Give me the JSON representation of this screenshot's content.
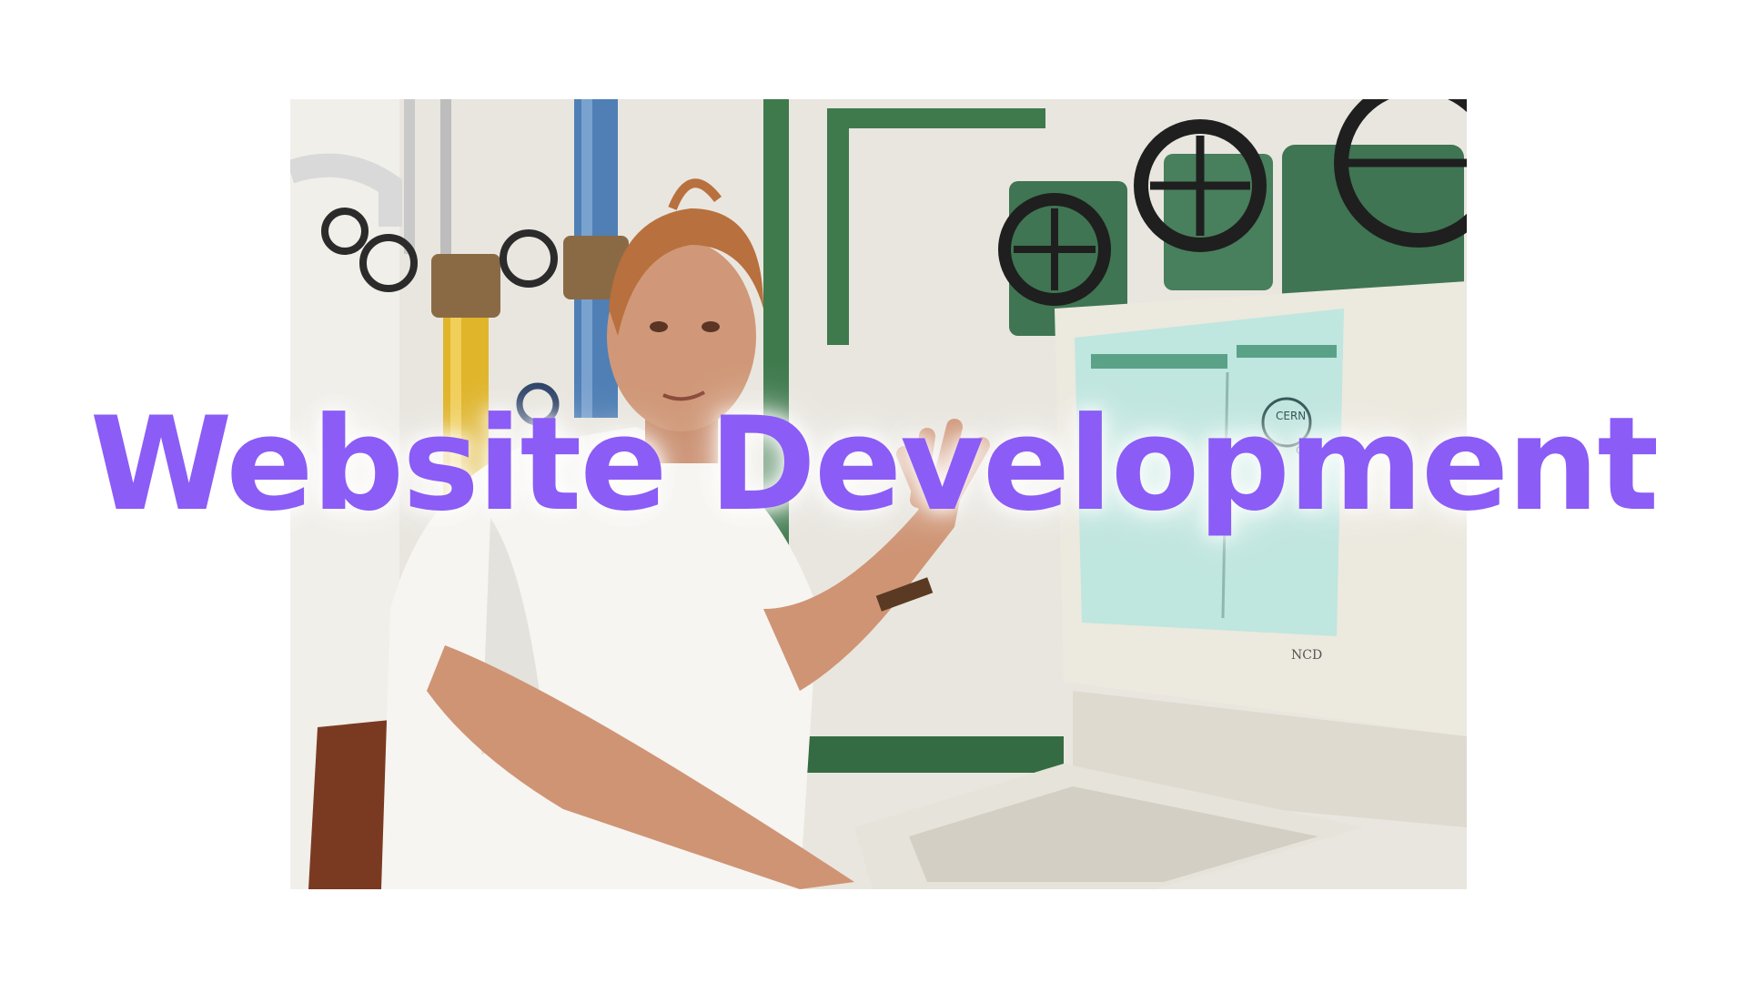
{
  "headline": {
    "text": "Website Development",
    "color": "#8b5cf6"
  },
  "photo": {
    "monitor_brand": "NCD",
    "screen_logo": "CERN",
    "screen_caption": "CERN"
  },
  "colors": {
    "background": "#ffffff",
    "wall": "#e9e6df",
    "pipe_blue": "#4f7fb5",
    "pipe_yellow": "#e0b52a",
    "pipe_green": "#3f7a4d",
    "valve_green": "#3f7552",
    "screen": "#bfe6df",
    "shirt": "#f6f5f1",
    "skin": "#d09878",
    "hair": "#b8703e"
  }
}
